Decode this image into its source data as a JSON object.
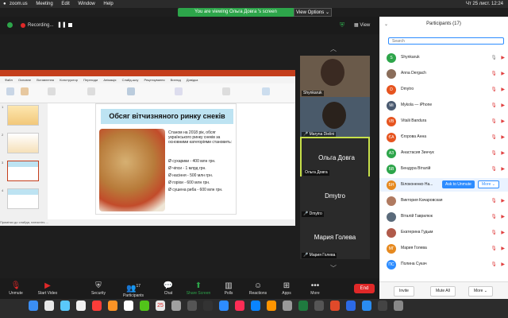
{
  "menubar": {
    "apple": "",
    "items": [
      "zoom.us",
      "Meeting",
      "Edit",
      "Window",
      "Help"
    ],
    "status_right": "Чт 25 лист.  12:24"
  },
  "banner": {
    "viewing": "You are viewing Ольга Довга 's screen",
    "view_options": "View Options ⌄"
  },
  "recording": {
    "label": "Recording...",
    "pause": "❚❚"
  },
  "view_label": "View",
  "ppt": {
    "tabs": [
      "Файл",
      "Основне",
      "Вставлення",
      "Конструктор",
      "Переходи",
      "Анімація",
      "Слайд-шоу",
      "Рецензування",
      "Вигляд",
      "Довідка"
    ],
    "status": "Примітки до слайда, натисніть ..."
  },
  "slide": {
    "title": "Обсяг вітчизняного ринку снеків",
    "intro": "Станом на 2018 рік, обсяг українського ринку снеків за основними категоріями становить:",
    "bullets": [
      "сухарики - 400 млн грн.",
      "чіпси - 1 млрд грн.",
      "насіння - 500 млн грн.",
      "горіхи - 600 млн грн.",
      "сушена риба - 600 млн грн."
    ]
  },
  "tiles": [
    {
      "name": "Shynkaruk",
      "big": ""
    },
    {
      "name": "Maryna Dielini",
      "big": ""
    },
    {
      "name": "Ольга Довга",
      "big": "Ольга Довга"
    },
    {
      "name": "Dmytro",
      "big": "Dmytro"
    },
    {
      "name": "Мария Голева",
      "big": "Мария Голева"
    }
  ],
  "panel": {
    "title": "Participants (17)",
    "search_placeholder": "Search",
    "participants": [
      {
        "initials": "S",
        "name": "Shynkaruk",
        "color": "#2da54a",
        "mic": "on"
      },
      {
        "initials": "",
        "name": "Anna Dergach",
        "color": "#8a6d5a",
        "mic": "off"
      },
      {
        "initials": "D",
        "name": "Dmytro",
        "color": "#e6541f",
        "mic": "off"
      },
      {
        "initials": "Mi",
        "name": "Mykola — iPhone",
        "color": "#4a5a70",
        "mic": "off"
      },
      {
        "initials": "VB",
        "name": "Vitalii Bandura",
        "color": "#e6541f",
        "mic": "off"
      },
      {
        "initials": "ЄА",
        "name": "Єгорова Анна",
        "color": "#e6541f",
        "mic": "off"
      },
      {
        "initials": "АЗ",
        "name": "Анастасия Зинчук",
        "color": "#2da54a",
        "mic": "off"
      },
      {
        "initials": "БВ",
        "name": "Бендура Віталій",
        "color": "#2da54a",
        "mic": "off"
      },
      {
        "initials": "БН",
        "name": "Білоконенко На...",
        "color": "#e6891f",
        "mic": "off",
        "buttons": {
          "unmute": "Ask to Unmute",
          "more": "More ⌄"
        }
      },
      {
        "initials": "",
        "name": "Виктория Качаровская",
        "color": "#b07a60",
        "mic": "off"
      },
      {
        "initials": "",
        "name": "Віталій Гаврилюк",
        "color": "#5a6a7a",
        "mic": "off"
      },
      {
        "initials": "",
        "name": "Екатерина Гудым",
        "color": "#b05a4a",
        "mic": "off"
      },
      {
        "initials": "МГ",
        "name": "Мария Голева",
        "color": "#e6891f",
        "mic": "off"
      },
      {
        "initials": "ПС",
        "name": "Полина Сукач",
        "color": "#2d8cff",
        "mic": "off"
      }
    ],
    "footer": {
      "invite": "Invite",
      "mute_all": "Mute All",
      "more": "More ⌄"
    }
  },
  "toolbar": {
    "unmute": "Unmute",
    "start_video": "Start Video",
    "security": "Security",
    "participants": "Participants",
    "participants_count": "17",
    "chat": "Chat",
    "share_screen": "Share Screen",
    "polls": "Polls",
    "reactions": "Reactions",
    "apps": "Apps",
    "more": "More",
    "end": "End"
  },
  "dock": {
    "calendar_day": "25"
  }
}
